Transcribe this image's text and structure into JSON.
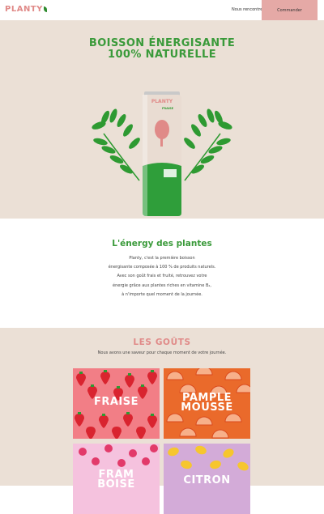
{
  "header": {
    "logo_text": "PLANTY",
    "nav_link": "Nous rencontrer",
    "order_button": "Commander"
  },
  "hero": {
    "title_line1": "BOISSON ÉNERGISANTE",
    "title_line2": "100% NATURELLE",
    "can_brand": "PLANTY",
    "can_flavor": "FRAISE"
  },
  "about": {
    "title": "L'énergy des plantes",
    "lines": [
      "Planty, c'est la première boisson",
      "énergisante composée à 100 % de produits naturels.",
      "Avec son goût frais et fruité, retrouvez votre",
      "énergie grâce aux plantes riches en vitamine B₂,",
      "à n'importe quel moment de la journée."
    ]
  },
  "flavors": {
    "title": "LES GOÛTS",
    "subtitle": "Nous avons une saveur pour chaque moment de votre journée.",
    "items": [
      {
        "lines": [
          "FRAISE"
        ]
      },
      {
        "lines": [
          "PAMPLE",
          "MOUSSE"
        ]
      },
      {
        "lines": [
          "FRAM",
          "BOISE"
        ]
      },
      {
        "lines": [
          "CITRON"
        ]
      }
    ]
  },
  "colors": {
    "brand_pink": "#e08a88",
    "brand_green": "#3a9a3a",
    "beige": "#ebe0d6",
    "button_pink": "#e5a9a6"
  }
}
